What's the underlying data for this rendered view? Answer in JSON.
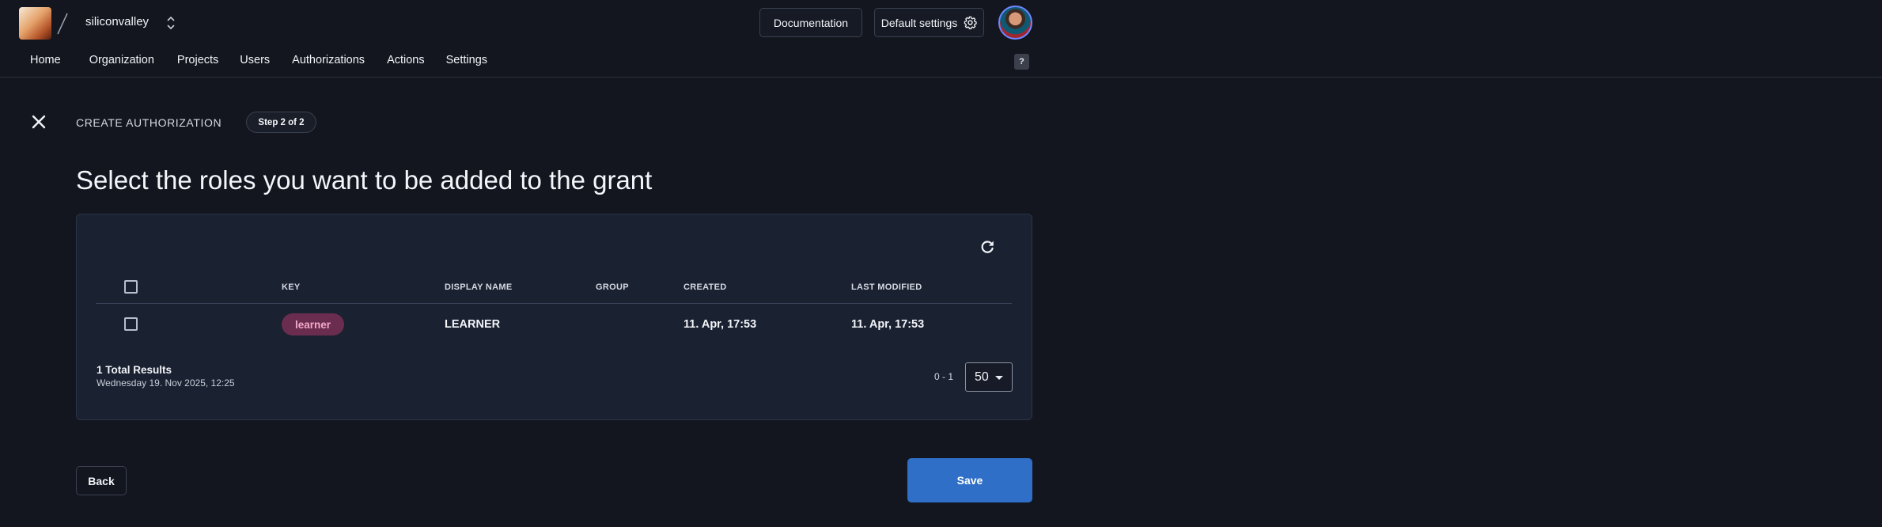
{
  "header": {
    "org_name": "siliconvalley",
    "docs_label": "Documentation",
    "settings_label": "Default settings",
    "help_label": "?"
  },
  "nav": {
    "items": [
      {
        "label": "Home"
      },
      {
        "label": "Organization"
      },
      {
        "label": "Projects"
      },
      {
        "label": "Users"
      },
      {
        "label": "Authorizations"
      },
      {
        "label": "Actions"
      },
      {
        "label": "Settings"
      }
    ]
  },
  "wizard": {
    "title": "CREATE AUTHORIZATION",
    "step": "Step 2 of 2",
    "heading": "Select the roles you want to be added to the grant"
  },
  "table": {
    "columns": {
      "key": "KEY",
      "display_name": "DISPLAY NAME",
      "group": "GROUP",
      "created": "CREATED",
      "last_modified": "LAST MODIFIED"
    },
    "rows": [
      {
        "key": "learner",
        "display_name": "LEARNER",
        "group": "",
        "created": "11. Apr, 17:53",
        "last_modified": "11. Apr, 17:53"
      }
    ],
    "total": "1 Total Results",
    "timestamp": "Wednesday 19. Nov 2025, 12:25",
    "range": "0 - 1",
    "page_size": "50"
  },
  "actions": {
    "back_label": "Back",
    "save_label": "Save"
  },
  "colors": {
    "background": "#13161f",
    "card": "#1a2131",
    "primary": "#2f6fc7",
    "key_chip_bg": "#6b2d4f",
    "key_chip_text": "#f4a9c9"
  },
  "icons": {
    "close": "close-icon",
    "refresh": "refresh-icon",
    "settings": "gear-icon",
    "org_switch": "chevron-up-down-icon"
  }
}
